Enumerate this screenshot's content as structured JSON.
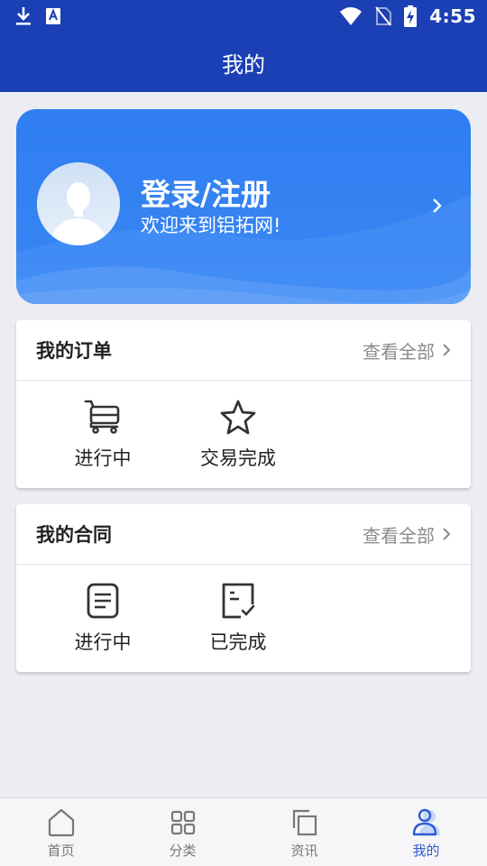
{
  "status_bar": {
    "time": "4:55",
    "icons": [
      "download-icon",
      "a-text-icon",
      "wifi-icon",
      "no-sim-icon",
      "battery-charging-icon"
    ]
  },
  "app_bar": {
    "title": "我的"
  },
  "profile": {
    "title": "登录/注册",
    "subtitle": "欢迎来到铝拓网!"
  },
  "orders": {
    "title": "我的订单",
    "view_all": "查看全部",
    "items": [
      {
        "label": "进行中",
        "icon": "cart-icon"
      },
      {
        "label": "交易完成",
        "icon": "star-icon"
      }
    ]
  },
  "contracts": {
    "title": "我的合同",
    "view_all": "查看全部",
    "items": [
      {
        "label": "进行中",
        "icon": "document-icon"
      },
      {
        "label": "已完成",
        "icon": "document-check-icon"
      }
    ]
  },
  "tab_bar": {
    "tabs": [
      {
        "label": "首页",
        "icon": "home-icon",
        "active": false
      },
      {
        "label": "分类",
        "icon": "grid-icon",
        "active": false
      },
      {
        "label": "资讯",
        "icon": "copy-icon",
        "active": false
      },
      {
        "label": "我的",
        "icon": "user-icon",
        "active": true
      }
    ]
  },
  "colors": {
    "header_blue": "#1b3fb4",
    "card_blue": "#2f7ef2",
    "active_tab": "#2f5bd3",
    "background": "#ebedf2"
  }
}
